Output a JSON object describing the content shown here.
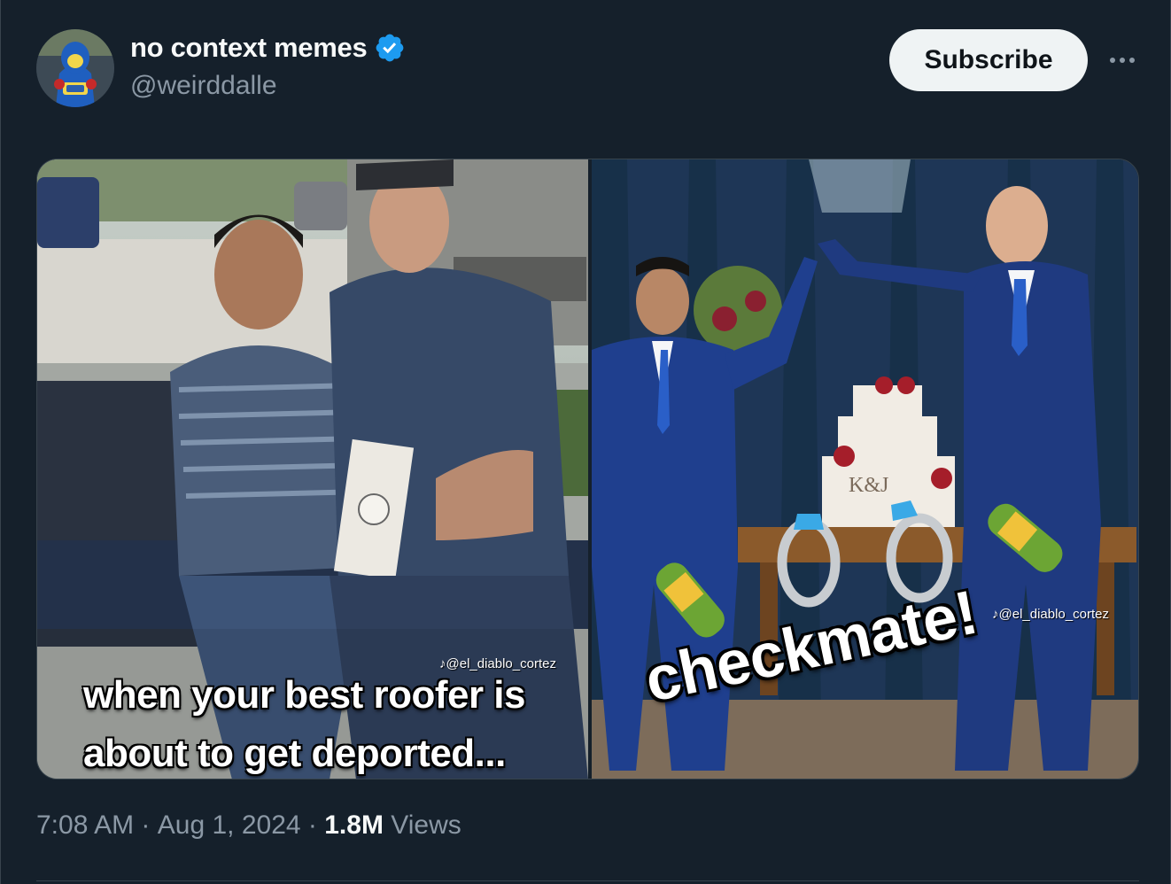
{
  "author": {
    "display_name": "no context memes",
    "handle": "@weirddalle",
    "verified": true,
    "verified_icon": "verified-badge-icon",
    "avatar_icon": "avatar-image"
  },
  "actions": {
    "subscribe_label": "Subscribe",
    "more_icon": "more-options-icon"
  },
  "media": {
    "left": {
      "caption_line1": "when your best roofer is",
      "caption_line2": "about to get deported...",
      "watermark": "♪@el_diablo_cortez"
    },
    "right": {
      "caption": "checkmate!",
      "watermark": "♪@el_diablo_cortez",
      "cake_text": "K&J"
    }
  },
  "meta": {
    "time": "7:08 AM",
    "sep1": " · ",
    "date": "Aug 1, 2024",
    "sep2": " · ",
    "views_count": "1.8M",
    "views_label": " Views"
  },
  "colors": {
    "background": "#15202b",
    "verified": "#1d9bf0",
    "secondary_text": "#8b98a5"
  }
}
